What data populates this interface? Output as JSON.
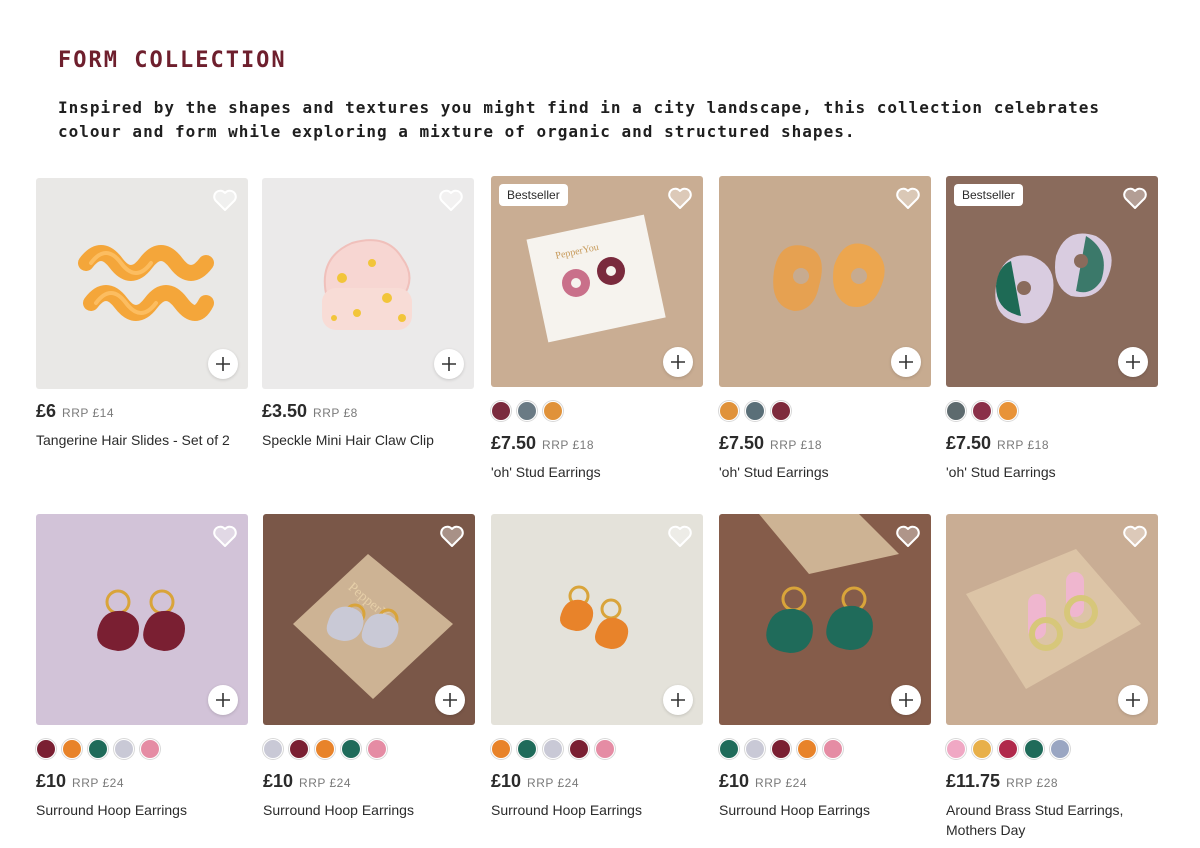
{
  "collection": {
    "title": "FORM COLLECTION",
    "description": "Inspired by the shapes and textures you might find in a city landscape, this collection celebrates colour and form while exploring a mixture of organic and structured shapes."
  },
  "products": [
    {
      "name": "Tangerine Hair Slides - Set of 2",
      "price": "£6",
      "rrp": "RRP £14",
      "badge": "",
      "bg": "#e9e8e6",
      "swatches": []
    },
    {
      "name": "Speckle Mini Hair Claw Clip",
      "price": "£3.50",
      "rrp": "RRP £8",
      "badge": "",
      "bg": "#ebeaea",
      "swatches": []
    },
    {
      "name": "'oh' Stud Earrings",
      "price": "£7.50",
      "rrp": "RRP £18",
      "badge": "Bestseller",
      "bg": "#c9ad93",
      "swatches": [
        "#7a2a3d",
        "#6a7a84",
        "#e0923a"
      ]
    },
    {
      "name": "'oh' Stud Earrings",
      "price": "£7.50",
      "rrp": "RRP £18",
      "badge": "",
      "bg": "#c7ab90",
      "swatches": [
        "#e0923a",
        "#5a6f78",
        "#7e2a3c"
      ]
    },
    {
      "name": "'oh' Stud Earrings",
      "price": "£7.50",
      "rrp": "RRP £18",
      "badge": "Bestseller",
      "bg": "#8a6b5c",
      "swatches": [
        "#5d6a6e",
        "#8a3049",
        "#e89338"
      ]
    },
    {
      "name": "Surround Hoop Earrings",
      "price": "£10",
      "rrp": "RRP £24",
      "badge": "",
      "bg": "#d2c3d8",
      "swatches": [
        "#7a1f32",
        "#e8832a",
        "#1f6b5a",
        "#c9c9d6",
        "#e58ca4"
      ]
    },
    {
      "name": "Surround Hoop Earrings",
      "price": "£10",
      "rrp": "RRP £24",
      "badge": "",
      "bg": "#7a5748",
      "swatches": [
        "#c9c9d6",
        "#7a1f32",
        "#e8832a",
        "#1f6b5a",
        "#e58ca4"
      ]
    },
    {
      "name": "Surround Hoop Earrings",
      "price": "£10",
      "rrp": "RRP £24",
      "badge": "",
      "bg": "#e4e2da",
      "swatches": [
        "#e8832a",
        "#1f6b5a",
        "#c9c9d6",
        "#7a1f32",
        "#e58ca4"
      ]
    },
    {
      "name": "Surround Hoop Earrings",
      "price": "£10",
      "rrp": "RRP £24",
      "badge": "",
      "bg": "#855c4a",
      "swatches": [
        "#1f6b5a",
        "#c9c9d6",
        "#7a1f32",
        "#e8832a",
        "#e58ca4"
      ]
    },
    {
      "name": "Around Brass Stud Earrings, Mothers Day",
      "price": "£11.75",
      "rrp": "RRP £28",
      "badge": "",
      "bg": "#c9ad94",
      "swatches": [
        "#f0a8c4",
        "#e8b04a",
        "#b0294b",
        "#1f6b5a",
        "#9aa6c2"
      ]
    }
  ]
}
